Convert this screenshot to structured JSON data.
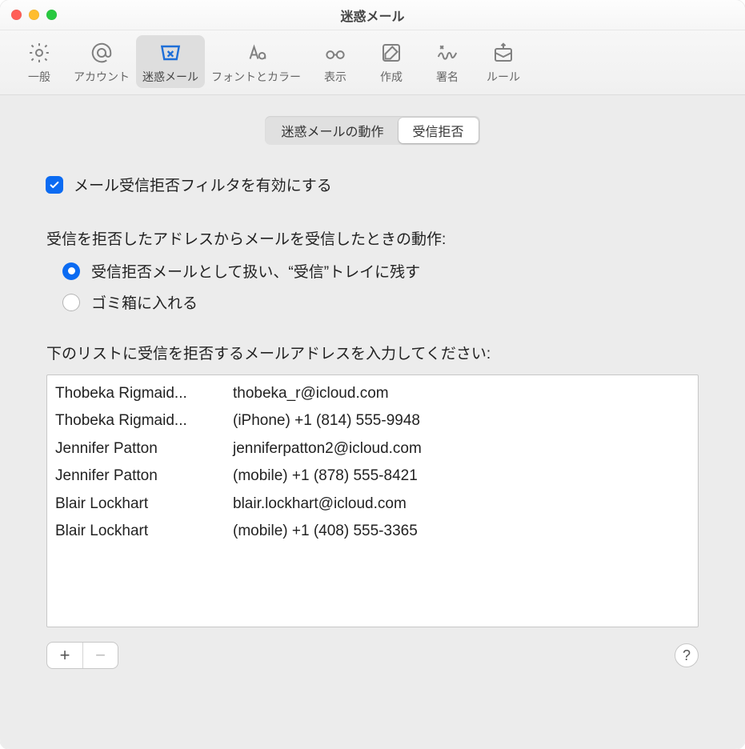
{
  "window": {
    "title": "迷惑メール"
  },
  "toolbar": {
    "items": [
      {
        "id": "general",
        "label": "一般"
      },
      {
        "id": "accounts",
        "label": "アカウント"
      },
      {
        "id": "junk",
        "label": "迷惑メール"
      },
      {
        "id": "fonts",
        "label": "フォントとカラー"
      },
      {
        "id": "viewing",
        "label": "表示"
      },
      {
        "id": "compose",
        "label": "作成"
      },
      {
        "id": "sign",
        "label": "署名"
      },
      {
        "id": "rules",
        "label": "ルール"
      }
    ],
    "selected": "junk"
  },
  "tabs": {
    "items": [
      {
        "id": "behavior",
        "label": "迷惑メールの動作"
      },
      {
        "id": "blocked",
        "label": "受信拒否"
      }
    ],
    "selected": "blocked"
  },
  "enable_filter": {
    "label": "メール受信拒否フィルタを有効にする",
    "checked": true
  },
  "when_received_label": "受信を拒否したアドレスからメールを受信したときの動作:",
  "radio": {
    "selected": "keep",
    "options": [
      {
        "id": "keep",
        "label": "受信拒否メールとして扱い、“受信”トレイに残す"
      },
      {
        "id": "trash",
        "label": "ゴミ箱に入れる"
      }
    ]
  },
  "list_label": "下のリストに受信を拒否するメールアドレスを入力してください:",
  "blocked_list": [
    {
      "name": "Thobeka Rigmaid...",
      "contact": "thobeka_r@icloud.com"
    },
    {
      "name": "Thobeka Rigmaid...",
      "contact": "(iPhone) +1 (814) 555-9948"
    },
    {
      "name": "Jennifer Patton",
      "contact": "jenniferpatton2@icloud.com"
    },
    {
      "name": "Jennifer Patton",
      "contact": "(mobile) +1 (878) 555-8421"
    },
    {
      "name": "Blair Lockhart",
      "contact": "blair.lockhart@icloud.com"
    },
    {
      "name": "Blair Lockhart",
      "contact": "(mobile) +1 (408) 555-3365"
    }
  ],
  "buttons": {
    "add": "+",
    "remove": "−",
    "help": "?"
  }
}
